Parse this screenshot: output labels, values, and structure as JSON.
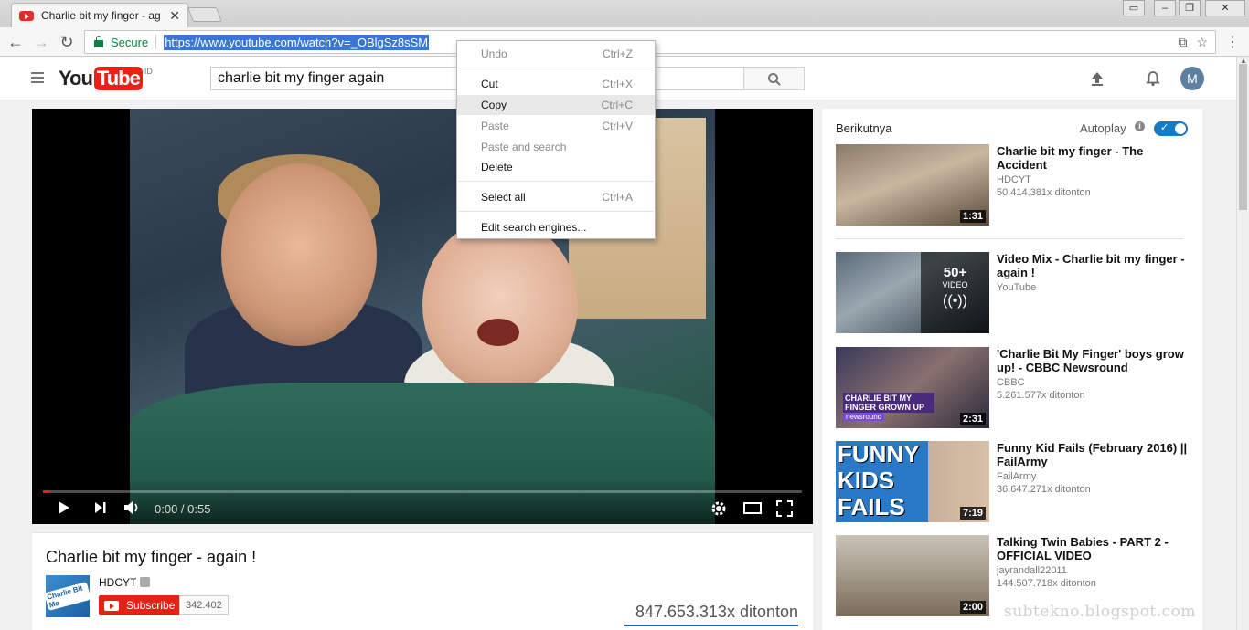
{
  "browser": {
    "tab_title": "Charlie bit my finger - ag",
    "tab_close": "✕",
    "window_controls": [
      "▭",
      "–",
      "❐",
      "✕"
    ],
    "secure_label": "Secure",
    "url": "https://www.youtube.com/watch?v=_OBlgSz8sSM"
  },
  "youtube": {
    "logo_you": "You",
    "logo_tube": "Tube",
    "country": "ID",
    "search_value": "charlie bit my finger again",
    "avatar_letter": "M"
  },
  "player": {
    "time": "0:00 / 0:55",
    "progress_fraction": 0.01
  },
  "video": {
    "title": "Charlie bit my finger - again !",
    "channel": "HDCYT",
    "channel_thumb_text": "Charlie Bit Me",
    "subscribe_label": "Subscribe",
    "subscriber_count": "342.402",
    "views": "847.653.313x ditonton"
  },
  "sidebar": {
    "up_next": "Berikutnya",
    "autoplay": "Autoplay",
    "autoplay_on": true,
    "items": [
      {
        "title": "Charlie bit my finger - The Accident",
        "channel": "HDCYT",
        "views": "50.414.381x ditonton",
        "duration": "1:31"
      },
      {
        "title": "Video Mix - Charlie bit my finger - again !",
        "channel": "YouTube",
        "views": "",
        "overlay_count": "50+",
        "overlay_label": "VIDEO"
      },
      {
        "title": "'Charlie Bit My Finger' boys grow up! - CBBC Newsround",
        "channel": "CBBC",
        "views": "5.261.577x ditonton",
        "duration": "2:31",
        "thumb_text": "CHARLIE BIT MY FINGER GROWN UP",
        "thumb_tag": "newsround"
      },
      {
        "title": "Funny Kid Fails (February 2016) || FailArmy",
        "channel": "FailArmy",
        "views": "36.647.271x ditonton",
        "duration": "7:19",
        "thumb_text": "FUNNY KIDS FAILS"
      },
      {
        "title": "Talking Twin Babies - PART 2 - OFFICIAL VIDEO",
        "channel": "jayrandall22011",
        "views": "144.507.718x ditonton",
        "duration": "2:00"
      }
    ]
  },
  "context_menu": {
    "items": [
      {
        "label": "Undo",
        "shortcut": "Ctrl+Z",
        "disabled": true
      },
      {
        "label": "Cut",
        "shortcut": "Ctrl+X",
        "disabled": false
      },
      {
        "label": "Copy",
        "shortcut": "Ctrl+C",
        "disabled": false,
        "highlighted": true
      },
      {
        "label": "Paste",
        "shortcut": "Ctrl+V",
        "disabled": true
      },
      {
        "label": "Paste and search",
        "shortcut": "",
        "disabled": true
      },
      {
        "label": "Delete",
        "shortcut": "",
        "disabled": false
      },
      {
        "label": "Select all",
        "shortcut": "Ctrl+A",
        "disabled": false
      },
      {
        "label": "Edit search engines...",
        "shortcut": "",
        "disabled": false
      }
    ]
  },
  "watermark": "subtekno.blogspot.com",
  "colors": {
    "youtube_red": "#e62117",
    "secure_green": "#0b8043",
    "url_selection": "#3a76d6",
    "toggle_blue": "#167ac6"
  }
}
